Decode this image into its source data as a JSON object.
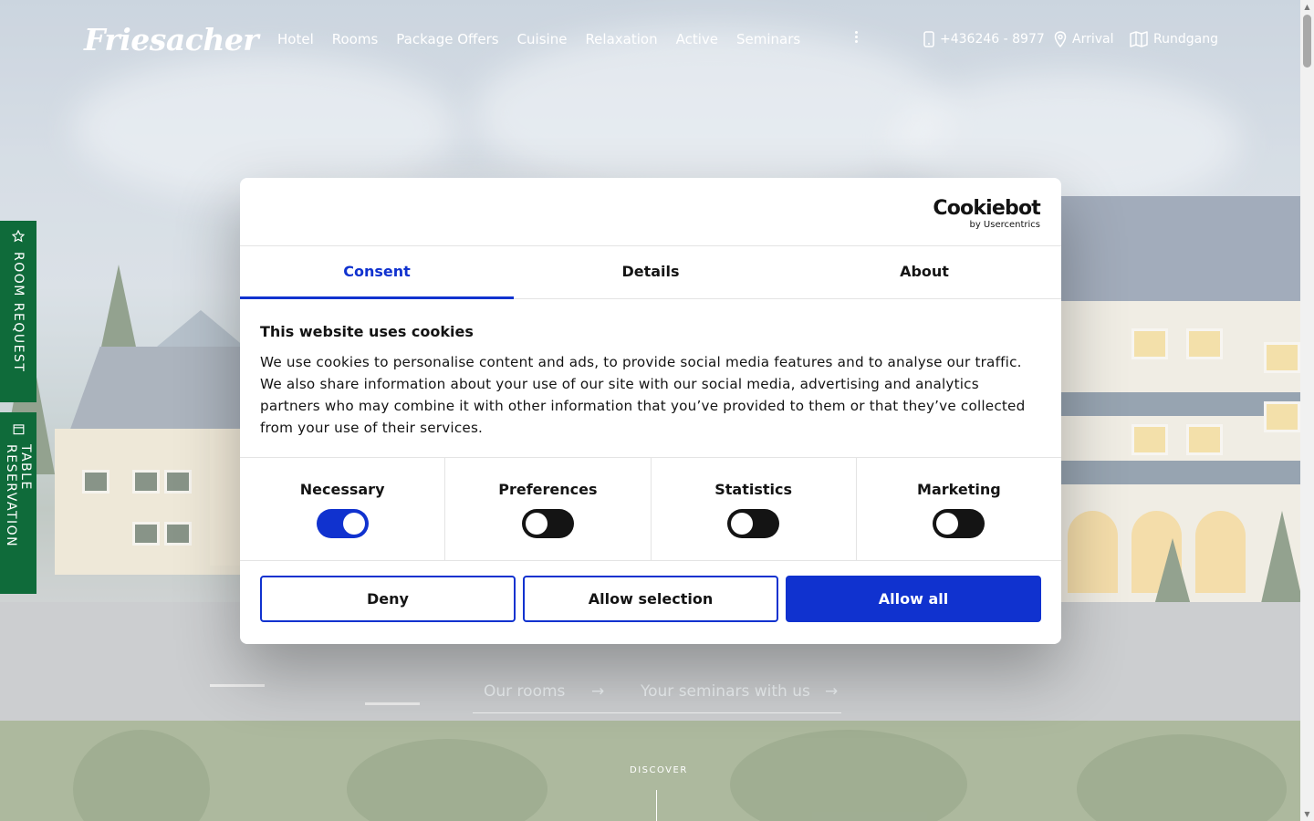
{
  "header": {
    "logo": "Friesacher",
    "nav": [
      "Hotel",
      "Rooms",
      "Package Offers",
      "Cuisine",
      "Relaxation",
      "Active",
      "Seminars"
    ],
    "more_icon": "vertical-dots-icon",
    "phone": "+436246 - 8977",
    "arrival": "Arrival",
    "tour": "Rundgang"
  },
  "side_tabs": {
    "room_request": "ROOM REQUEST",
    "table_reservation": "TABLE RESERVATION"
  },
  "hero": {
    "link_rooms": "Our rooms",
    "link_seminars": "Your seminars with us",
    "discover": "DISCOVER"
  },
  "cookie_dialog": {
    "brand": "Cookiebot",
    "brand_sub": "by Usercentrics",
    "tabs": [
      "Consent",
      "Details",
      "About"
    ],
    "active_tab": "Consent",
    "heading": "This website uses cookies",
    "text": "We use cookies to personalise content and ads, to provide social media features and to analyse our traffic. We also share information about your use of our site with our social media, advertising and analytics partners who may combine it with other information that you’ve provided to them or that they’ve collected from your use of their services.",
    "toggles": [
      {
        "label": "Necessary",
        "on": true
      },
      {
        "label": "Preferences",
        "on": false
      },
      {
        "label": "Statistics",
        "on": false
      },
      {
        "label": "Marketing",
        "on": false
      }
    ],
    "buttons": {
      "deny": "Deny",
      "allow_selection": "Allow selection",
      "allow_all": "Allow all"
    }
  },
  "colors": {
    "accent": "#1032cf",
    "side_tab_green": "#0f6b3a"
  }
}
